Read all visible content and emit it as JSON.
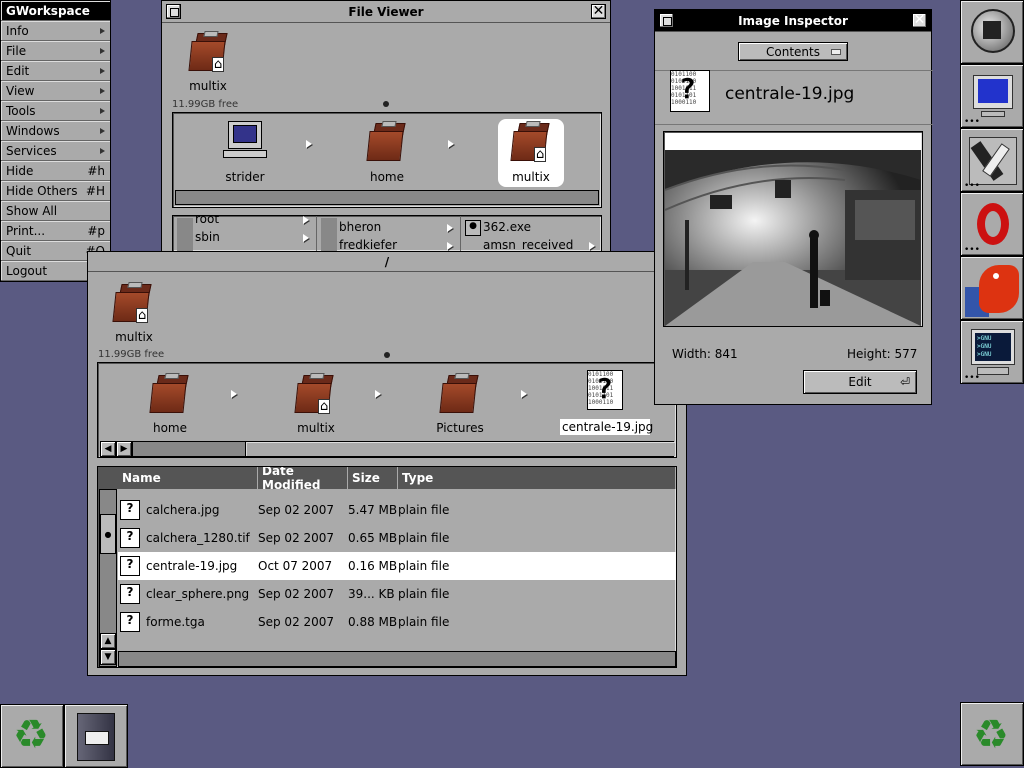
{
  "menu": {
    "title": "GWorkspace",
    "items": [
      {
        "label": "Info",
        "shortcut": "",
        "submenu": true
      },
      {
        "label": "File",
        "shortcut": "",
        "submenu": true
      },
      {
        "label": "Edit",
        "shortcut": "",
        "submenu": true
      },
      {
        "label": "View",
        "shortcut": "",
        "submenu": true
      },
      {
        "label": "Tools",
        "shortcut": "",
        "submenu": true
      },
      {
        "label": "Windows",
        "shortcut": "",
        "submenu": true
      },
      {
        "label": "Services",
        "shortcut": "",
        "submenu": true
      },
      {
        "label": "Hide",
        "shortcut": "#h",
        "submenu": false
      },
      {
        "label": "Hide Others",
        "shortcut": "#H",
        "submenu": false
      },
      {
        "label": "Show All",
        "shortcut": "",
        "submenu": false
      },
      {
        "label": "Print...",
        "shortcut": "#p",
        "submenu": false
      },
      {
        "label": "Quit",
        "shortcut": "#Q",
        "submenu": false
      },
      {
        "label": "Logout",
        "shortcut": "",
        "submenu": false
      }
    ]
  },
  "viewer": {
    "title": "File Viewer",
    "top_icon": "multix",
    "free": "11.99GB free",
    "path": [
      "strider",
      "home",
      "multix"
    ],
    "browser": {
      "col1": [
        "root",
        "sbin"
      ],
      "col2": [
        "bheron",
        "fredkiefer"
      ],
      "col3": [
        "362.exe",
        "amsn_received"
      ]
    }
  },
  "main": {
    "title": "/",
    "top_icon": "multix",
    "free": "11.99GB free",
    "path": [
      "home",
      "multix",
      "Pictures",
      "centrale-19.jpg"
    ],
    "columns": {
      "name": "Name",
      "date": "Date Modified",
      "size": "Size",
      "type": "Type"
    },
    "rows": [
      {
        "name": "calchera.jpg",
        "date": "Sep 02 2007",
        "size": "5.47 MB",
        "type": "plain file",
        "selected": false
      },
      {
        "name": "calchera_1280.tif",
        "date": "Sep 02 2007",
        "size": "0.65 MB",
        "type": "plain file",
        "selected": false
      },
      {
        "name": "centrale-19.jpg",
        "date": "Oct 07 2007",
        "size": "0.16 MB",
        "type": "plain file",
        "selected": true
      },
      {
        "name": "clear_sphere.png",
        "date": "Sep 02 2007",
        "size": "39... KB",
        "type": "plain file",
        "selected": false
      },
      {
        "name": "forme.tga",
        "date": "Sep 02 2007",
        "size": "0.88 MB",
        "type": "plain file",
        "selected": false
      }
    ]
  },
  "inspector": {
    "title": "Image Inspector",
    "popup": "Contents",
    "filename": "centrale-19.jpg",
    "width_label": "Width: 841",
    "height_label": "Height: 577",
    "edit_label": "Edit"
  },
  "dock": [
    "gworkspace-icon",
    "monitor-icon",
    "tools-icon",
    "opera-icon",
    "mozilla-icon",
    "terminal-icon",
    "recycler-icon"
  ],
  "colors": {
    "desktop": "#5a5a82",
    "window": "#aaaaaa",
    "title_active": "#000000",
    "selection": "#ffffff"
  }
}
